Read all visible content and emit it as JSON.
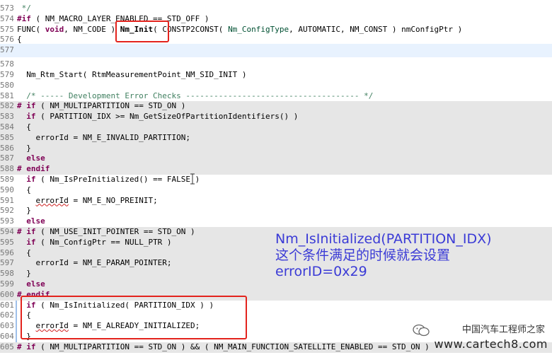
{
  "lines": [
    {
      "num": "573",
      "code": " */",
      "style": "comment"
    },
    {
      "num": "574",
      "code": "#if ( NM_MACRO_LAYER_ENABLED == STD_OFF )",
      "style": "pp"
    },
    {
      "num": "575",
      "code": "FUNC( void, NM_CODE ) Nm_Init( CONSTP2CONST( Nm_ConfigType, AUTOMATIC, NM_CONST ) nmConfigPtr )",
      "style": "func"
    },
    {
      "num": "576",
      "code": "{",
      "style": "plain"
    },
    {
      "num": "577",
      "code": "",
      "style": "cursor"
    },
    {
      "num": "578",
      "code": "",
      "style": "plain"
    },
    {
      "num": "579",
      "code": "  Nm_Rtm_Start( RtmMeasurementPoint_NM_SID_INIT )",
      "style": "plain"
    },
    {
      "num": "580",
      "code": "",
      "style": "plain"
    },
    {
      "num": "581",
      "code": "  /* ----- Development Error Checks ------------------------------------- */",
      "style": "comment"
    },
    {
      "num": "582",
      "code": "# if ( NM_MULTIPARTITION == STD_ON )",
      "style": "pp-shade"
    },
    {
      "num": "583",
      "code": "  if ( PARTITION_IDX >= Nm_GetSizeOfPartitionIdentifiers() )",
      "style": "if-shade"
    },
    {
      "num": "584",
      "code": "  {",
      "style": "shade"
    },
    {
      "num": "585",
      "code": "    errorId = NM_E_INVALID_PARTITION;",
      "style": "shade"
    },
    {
      "num": "586",
      "code": "  }",
      "style": "shade"
    },
    {
      "num": "587",
      "code": "  else",
      "style": "else-shade"
    },
    {
      "num": "588",
      "code": "# endif",
      "style": "pp-shade"
    },
    {
      "num": "589",
      "code": "  if ( Nm_IsPreInitialized() == FALSE )",
      "style": "if"
    },
    {
      "num": "590",
      "code": "  {",
      "style": "plain"
    },
    {
      "num": "591",
      "code": "    errorId = NM_E_NO_PREINIT;",
      "style": "squig"
    },
    {
      "num": "592",
      "code": "  }",
      "style": "plain"
    },
    {
      "num": "593",
      "code": "  else",
      "style": "else"
    },
    {
      "num": "594",
      "code": "# if ( NM_USE_INIT_POINTER == STD_ON )",
      "style": "pp-shade"
    },
    {
      "num": "595",
      "code": "  if ( Nm_ConfigPtr == NULL_PTR )",
      "style": "if-shade"
    },
    {
      "num": "596",
      "code": "  {",
      "style": "shade"
    },
    {
      "num": "597",
      "code": "    errorId = NM_E_PARAM_POINTER;",
      "style": "shade"
    },
    {
      "num": "598",
      "code": "  }",
      "style": "shade"
    },
    {
      "num": "599",
      "code": "  else",
      "style": "else-shade"
    },
    {
      "num": "600",
      "code": "# endif",
      "style": "pp-shade"
    },
    {
      "num": "601",
      "code": "  if ( Nm_IsInitialized( PARTITION_IDX ) )",
      "style": "if"
    },
    {
      "num": "602",
      "code": "  {",
      "style": "plain"
    },
    {
      "num": "603",
      "code": "    errorId = NM_E_ALREADY_INITIALIZED;",
      "style": "squig"
    },
    {
      "num": "604",
      "code": "  }",
      "style": "plain"
    },
    {
      "num": "605",
      "code": "# if ( NM_MULTIPARTITION == STD_ON ) && ( NM_MAIN_FUNCTION_SATELLITE_ENABLED == STD_ON )",
      "style": "pp-shade"
    }
  ],
  "annotation": {
    "line1": "Nm_IsInitialized(PARTITION_IDX)",
    "line2": "这个条件满足的时候就会设置",
    "line3": "errorID=0x29"
  },
  "watermark": {
    "title": "中国汽车工程师之家",
    "url": "www.cartech8.com"
  },
  "colors": {
    "highlight_box": "#e3231d",
    "annotation_text": "#3b3bd6",
    "keyword": "#7f0055",
    "comment": "#3f7f5f",
    "shaded_line": "#e6e6e6"
  }
}
